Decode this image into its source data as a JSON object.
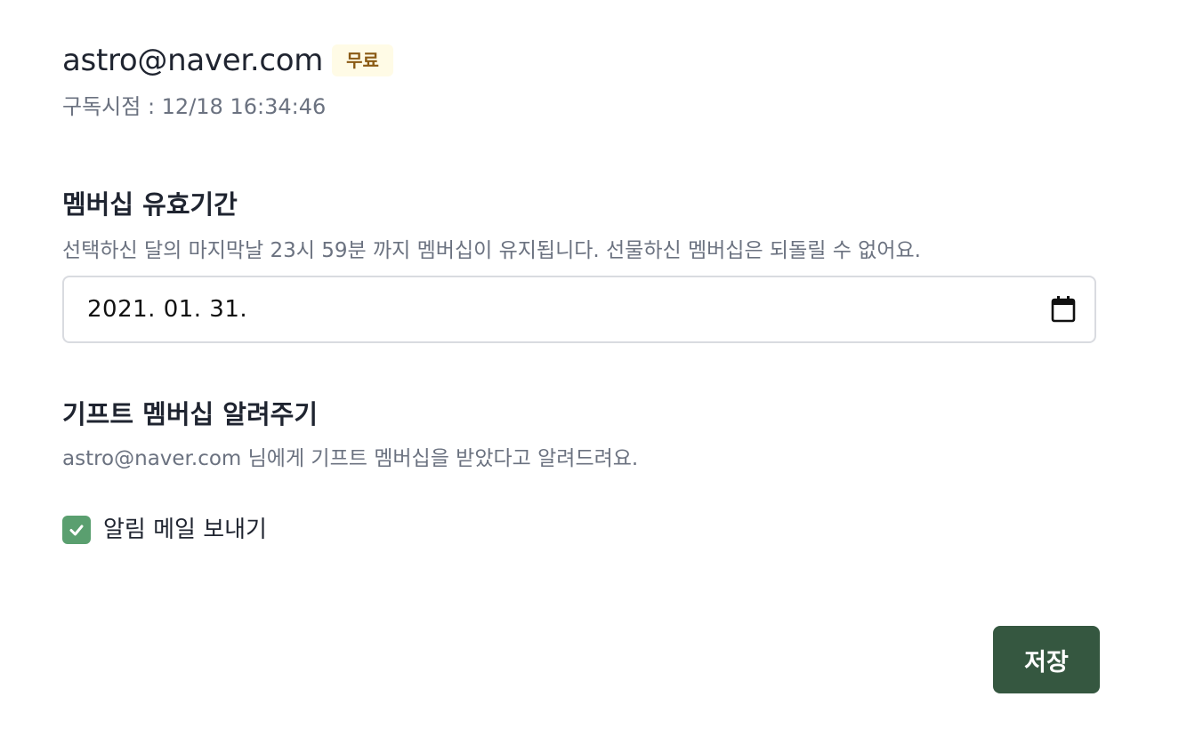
{
  "user": {
    "email": "astro@naver.com",
    "plan_badge": "무료",
    "subscribed_at": "구독시점 : 12/18 16:34:46"
  },
  "membership_period": {
    "title": "멤버십 유효기간",
    "description": "선택하신 달의 마지막날 23시 59분 까지 멤버십이 유지됩니다. 선물하신 멤버십은 되돌릴 수 없어요.",
    "date_value": "2021. 01. 31.",
    "calendar_icon": "calendar-icon"
  },
  "gift_notification": {
    "title": "기프트 멤버십 알려주기",
    "description": "astro@naver.com 님에게 기프트 멤버십을 받았다고 알려드려요.",
    "checkbox_label": "알림 메일 보내기",
    "checkbox_checked": true,
    "checkbox_color": "#5a9f6f"
  },
  "actions": {
    "save_label": "저장",
    "save_color": "#355740"
  },
  "colors": {
    "badge_bg": "#fffbe6",
    "badge_text": "#8a5a14"
  }
}
